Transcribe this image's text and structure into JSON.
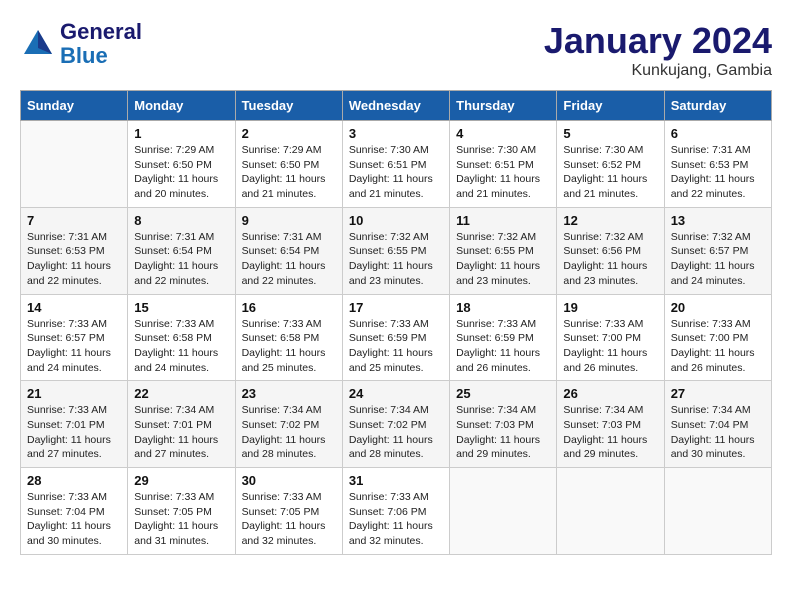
{
  "logo": {
    "line1": "General",
    "line2": "Blue"
  },
  "title": "January 2024",
  "location": "Kunkujang, Gambia",
  "weekdays": [
    "Sunday",
    "Monday",
    "Tuesday",
    "Wednesday",
    "Thursday",
    "Friday",
    "Saturday"
  ],
  "weeks": [
    [
      {
        "day": "",
        "info": ""
      },
      {
        "day": "1",
        "info": "Sunrise: 7:29 AM\nSunset: 6:50 PM\nDaylight: 11 hours\nand 20 minutes."
      },
      {
        "day": "2",
        "info": "Sunrise: 7:29 AM\nSunset: 6:50 PM\nDaylight: 11 hours\nand 21 minutes."
      },
      {
        "day": "3",
        "info": "Sunrise: 7:30 AM\nSunset: 6:51 PM\nDaylight: 11 hours\nand 21 minutes."
      },
      {
        "day": "4",
        "info": "Sunrise: 7:30 AM\nSunset: 6:51 PM\nDaylight: 11 hours\nand 21 minutes."
      },
      {
        "day": "5",
        "info": "Sunrise: 7:30 AM\nSunset: 6:52 PM\nDaylight: 11 hours\nand 21 minutes."
      },
      {
        "day": "6",
        "info": "Sunrise: 7:31 AM\nSunset: 6:53 PM\nDaylight: 11 hours\nand 22 minutes."
      }
    ],
    [
      {
        "day": "7",
        "info": "Sunrise: 7:31 AM\nSunset: 6:53 PM\nDaylight: 11 hours\nand 22 minutes."
      },
      {
        "day": "8",
        "info": "Sunrise: 7:31 AM\nSunset: 6:54 PM\nDaylight: 11 hours\nand 22 minutes."
      },
      {
        "day": "9",
        "info": "Sunrise: 7:31 AM\nSunset: 6:54 PM\nDaylight: 11 hours\nand 22 minutes."
      },
      {
        "day": "10",
        "info": "Sunrise: 7:32 AM\nSunset: 6:55 PM\nDaylight: 11 hours\nand 23 minutes."
      },
      {
        "day": "11",
        "info": "Sunrise: 7:32 AM\nSunset: 6:55 PM\nDaylight: 11 hours\nand 23 minutes."
      },
      {
        "day": "12",
        "info": "Sunrise: 7:32 AM\nSunset: 6:56 PM\nDaylight: 11 hours\nand 23 minutes."
      },
      {
        "day": "13",
        "info": "Sunrise: 7:32 AM\nSunset: 6:57 PM\nDaylight: 11 hours\nand 24 minutes."
      }
    ],
    [
      {
        "day": "14",
        "info": "Sunrise: 7:33 AM\nSunset: 6:57 PM\nDaylight: 11 hours\nand 24 minutes."
      },
      {
        "day": "15",
        "info": "Sunrise: 7:33 AM\nSunset: 6:58 PM\nDaylight: 11 hours\nand 24 minutes."
      },
      {
        "day": "16",
        "info": "Sunrise: 7:33 AM\nSunset: 6:58 PM\nDaylight: 11 hours\nand 25 minutes."
      },
      {
        "day": "17",
        "info": "Sunrise: 7:33 AM\nSunset: 6:59 PM\nDaylight: 11 hours\nand 25 minutes."
      },
      {
        "day": "18",
        "info": "Sunrise: 7:33 AM\nSunset: 6:59 PM\nDaylight: 11 hours\nand 26 minutes."
      },
      {
        "day": "19",
        "info": "Sunrise: 7:33 AM\nSunset: 7:00 PM\nDaylight: 11 hours\nand 26 minutes."
      },
      {
        "day": "20",
        "info": "Sunrise: 7:33 AM\nSunset: 7:00 PM\nDaylight: 11 hours\nand 26 minutes."
      }
    ],
    [
      {
        "day": "21",
        "info": "Sunrise: 7:33 AM\nSunset: 7:01 PM\nDaylight: 11 hours\nand 27 minutes."
      },
      {
        "day": "22",
        "info": "Sunrise: 7:34 AM\nSunset: 7:01 PM\nDaylight: 11 hours\nand 27 minutes."
      },
      {
        "day": "23",
        "info": "Sunrise: 7:34 AM\nSunset: 7:02 PM\nDaylight: 11 hours\nand 28 minutes."
      },
      {
        "day": "24",
        "info": "Sunrise: 7:34 AM\nSunset: 7:02 PM\nDaylight: 11 hours\nand 28 minutes."
      },
      {
        "day": "25",
        "info": "Sunrise: 7:34 AM\nSunset: 7:03 PM\nDaylight: 11 hours\nand 29 minutes."
      },
      {
        "day": "26",
        "info": "Sunrise: 7:34 AM\nSunset: 7:03 PM\nDaylight: 11 hours\nand 29 minutes."
      },
      {
        "day": "27",
        "info": "Sunrise: 7:34 AM\nSunset: 7:04 PM\nDaylight: 11 hours\nand 30 minutes."
      }
    ],
    [
      {
        "day": "28",
        "info": "Sunrise: 7:33 AM\nSunset: 7:04 PM\nDaylight: 11 hours\nand 30 minutes."
      },
      {
        "day": "29",
        "info": "Sunrise: 7:33 AM\nSunset: 7:05 PM\nDaylight: 11 hours\nand 31 minutes."
      },
      {
        "day": "30",
        "info": "Sunrise: 7:33 AM\nSunset: 7:05 PM\nDaylight: 11 hours\nand 32 minutes."
      },
      {
        "day": "31",
        "info": "Sunrise: 7:33 AM\nSunset: 7:06 PM\nDaylight: 11 hours\nand 32 minutes."
      },
      {
        "day": "",
        "info": ""
      },
      {
        "day": "",
        "info": ""
      },
      {
        "day": "",
        "info": ""
      }
    ]
  ]
}
